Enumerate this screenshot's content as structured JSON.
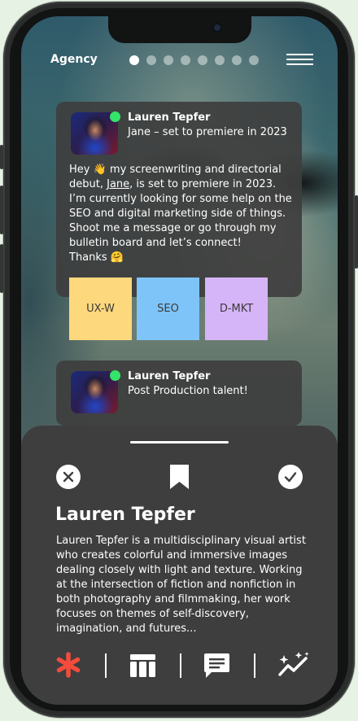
{
  "header": {
    "brand": "Agency",
    "page_dots": {
      "total": 8,
      "active_index": 0
    }
  },
  "cards": [
    {
      "author": "Lauren Tepfer",
      "subtitle": "Jane – set to premiere in 2023",
      "body_pre": "Hey 👋 my screenwriting and directorial debut, ",
      "body_link": "Jane",
      "body_post": ", is set to premiere in 2023. I’m currently looking for some help on the SEO and digital marketing side of things. Shoot me a message or go through my bulletin board and let’s connect!\nThanks 🤗",
      "tags": [
        {
          "label": "UX-W",
          "color": "#fdd87c"
        },
        {
          "label": "SEO",
          "color": "#7ec4f8"
        },
        {
          "label": "D-MKT",
          "color": "#d6b4f8"
        }
      ]
    },
    {
      "author": "Lauren Tepfer",
      "subtitle": "Post Production talent!"
    }
  ],
  "sheet": {
    "actions": [
      "close-icon",
      "bookmark-icon",
      "check-icon"
    ],
    "profile_name": "Lauren Tepfer",
    "bio": "Lauren Tepfer is a multidisciplinary visual artist who creates colorful and immersive images dealing closely with light and texture. Working at the intersection of fiction and nonfiction in both photography and filmmaking, her work focuses on themes of self-discovery, imagination, and futures..."
  },
  "bottom_nav": [
    "asterisk-icon",
    "board-icon",
    "chat-icon",
    "sparkle-chart-icon"
  ],
  "colors": {
    "accent": "#f24c3d",
    "online": "#34e36a",
    "sheet": "#3e3e3e"
  }
}
